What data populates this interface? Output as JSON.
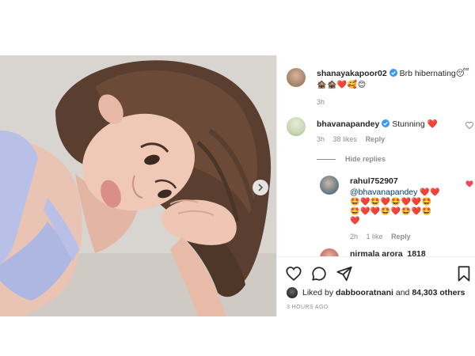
{
  "post": {
    "owner": "shanayakapoor02",
    "caption": "Brb hibernating😴",
    "caption_emojis": "🏚️🏚️❤️🥰😊",
    "caption_time": "3h",
    "liked_by_prefix": "Liked by",
    "liked_by_user": "dabbooratnani",
    "liked_by_and": "and",
    "likes_count": "84,303 others",
    "posted_ago": "3 HOURS AGO"
  },
  "comments": [
    {
      "user": "bhavanapandey",
      "text": "Stunning ❤️",
      "time": "3h",
      "likes": "38 likes",
      "reply_label": "Reply",
      "liked": false
    }
  ],
  "hide_replies_label": "Hide replies",
  "replies": [
    {
      "user": "rahul752907",
      "mention": "@bhavanapandey",
      "emojis_line1": "❤️❤️",
      "emojis_line2": "🤩❤️🤩❤️🤩❤️❤️🤩",
      "emojis_line3": "🤩❤️❤️🤩❤️🤩❤️🤩",
      "emojis_line4": "❤️",
      "time": "2h",
      "likes": "1 like",
      "reply_label": "Reply",
      "liked": true
    },
    {
      "user": "nirmala arora_1818"
    }
  ],
  "icons": {
    "like": "heart-outline-icon",
    "comment": "comment-bubble-icon",
    "share": "paper-plane-icon",
    "save": "bookmark-icon",
    "carousel_next": "chevron-right-icon"
  },
  "colors": {
    "verified": "#3897f0",
    "heart_red": "#ed4956",
    "muted": "#8e8e8e",
    "text": "#262626"
  }
}
